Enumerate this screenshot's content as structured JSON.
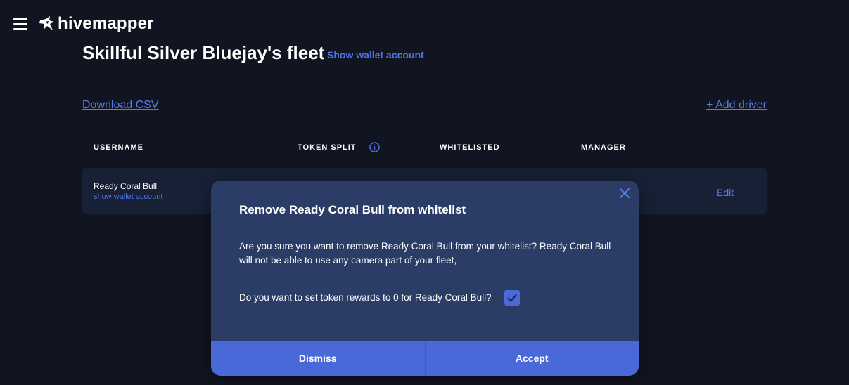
{
  "header": {
    "menu_icon": "hamburger-icon",
    "logo_icon": "bee-logo-icon",
    "logo_text": "hivemapper"
  },
  "fleet": {
    "title": "Skillful Silver Bluejay's fleet",
    "wallet_link": "Show wallet account",
    "download_csv": "Download CSV",
    "add_driver": "+ Add driver"
  },
  "table": {
    "columns": [
      "USERNAME",
      "TOKEN SPLIT",
      "WHITELISTED",
      "MANAGER"
    ],
    "info_icon": "info-circle-icon",
    "rows": [
      {
        "username": "Ready Coral Bull",
        "wallet_link": "show wallet account",
        "edit": "Edit"
      }
    ]
  },
  "modal": {
    "title": "Remove Ready Coral Bull from whitelist",
    "body": "Are you sure you want to remove Ready Coral Bull from your whitelist? Ready Coral Bull will not be able to use any camera part of your fleet,",
    "question": "Do you want to set token rewards to 0 for Ready Coral Bull?",
    "checkbox_checked": true,
    "close_icon": "close-icon",
    "dismiss": "Dismiss",
    "accept": "Accept"
  },
  "colors": {
    "background": "#111521",
    "accent": "#4a69d8",
    "link": "#5a7de6",
    "modal_bg": "#2b3c66",
    "row_bg": "#182036"
  }
}
